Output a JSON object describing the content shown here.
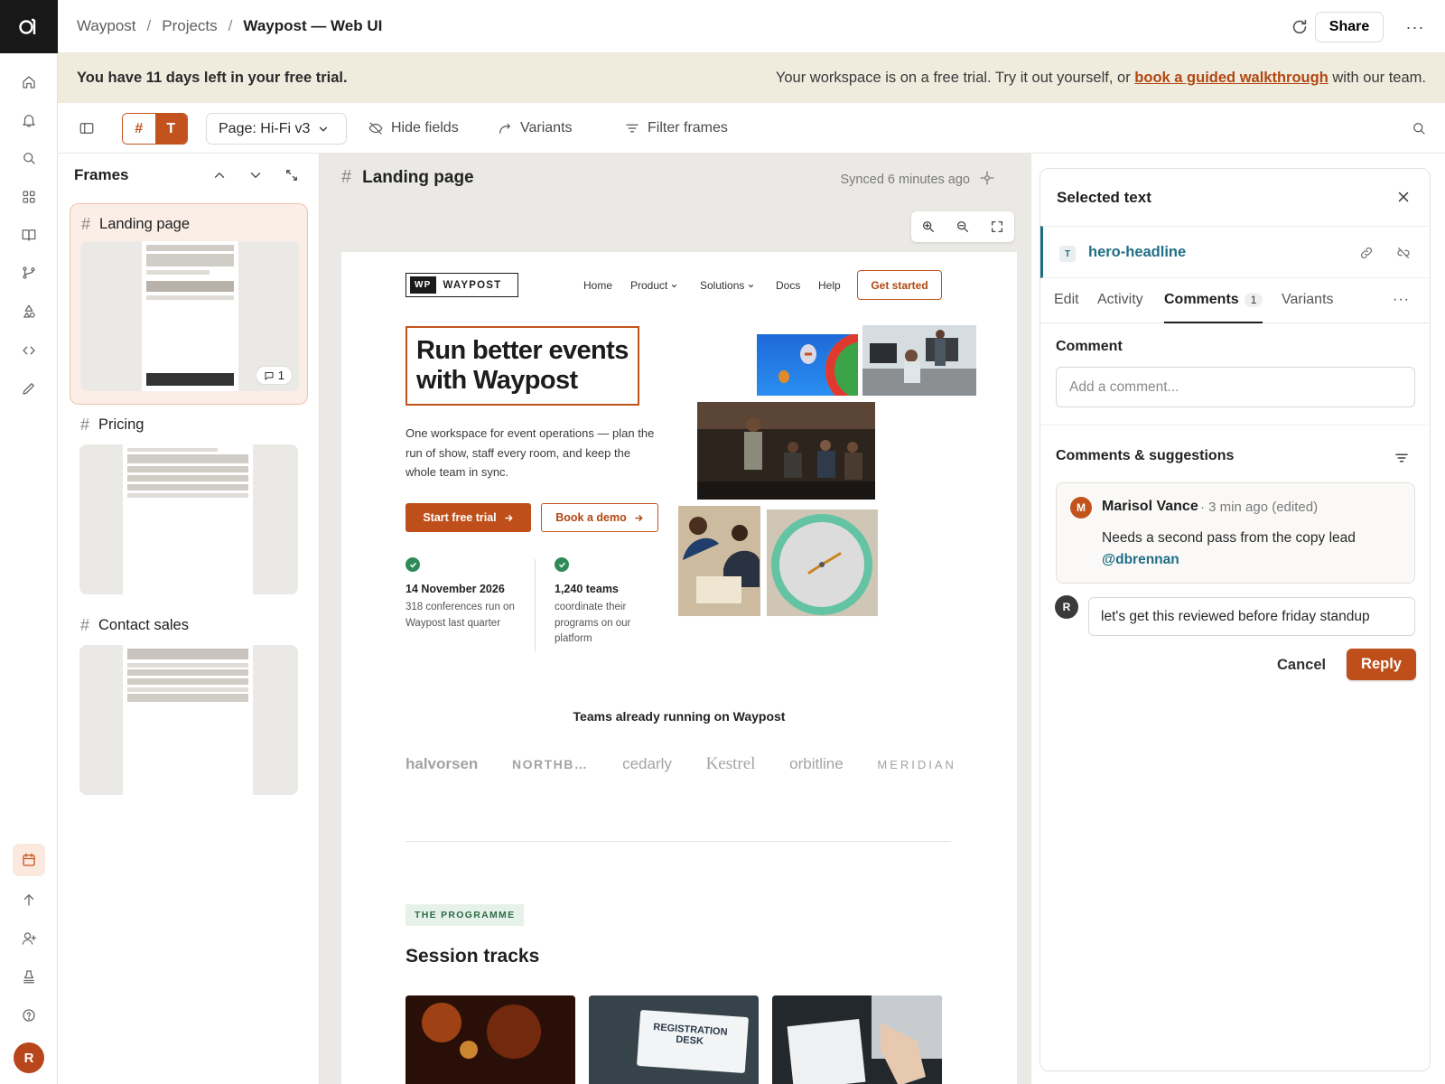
{
  "breadcrumb": {
    "items": [
      "Waypost",
      "Projects",
      "Waypost — Web UI"
    ],
    "separator": "/"
  },
  "topbar": {
    "share_label": "Share",
    "more": "···"
  },
  "banner": {
    "left": "You have 11 days left in your free trial.",
    "right_before": "Your workspace is on a free trial. Try it out yourself, or ",
    "link": "book a guided walkthrough",
    "right_after": " with our team."
  },
  "toolbar": {
    "seg_frame": "#",
    "seg_text": "T",
    "page": "Page: Hi-Fi v3",
    "hide_fields": "Hide fields",
    "variants": "Variants",
    "filter_frames": "Filter frames"
  },
  "frames": {
    "title": "Frames",
    "items": [
      {
        "name": "Landing page",
        "comments": "1"
      },
      {
        "name": "Pricing"
      },
      {
        "name": "Contact sales"
      }
    ]
  },
  "canvas": {
    "frame_title": "Landing page",
    "synced": "Synced 6 minutes ago"
  },
  "site": {
    "logo_mark": "WP",
    "logo_name": "WAYPOST",
    "nav": [
      "Home",
      "Product",
      "Solutions",
      "Docs",
      "Help"
    ],
    "cta": "Get started",
    "hero_line1": "Run better events",
    "hero_line2": "with Waypost",
    "subhead": "One workspace for event operations — plan the run of show, staff every room, and keep the whole team in sync.",
    "primary_btn": "Start free trial",
    "secondary_btn": "Book a demo",
    "stats": [
      {
        "value": "14 November 2026",
        "desc": "318 conferences run on Waypost last quarter"
      },
      {
        "value": "1,240 teams",
        "desc": "coordinate their programs on our platform"
      }
    ],
    "teams_heading": "Teams already running on Waypost",
    "logos": [
      "halvorsen",
      "NORTHB…",
      "cedarly",
      "Kestrel",
      "orbitline",
      "MERIDIAN"
    ],
    "tag": "THE PROGRAMME",
    "tracks_heading": "Session tracks",
    "track_image_text": "REGISTRATION DESK"
  },
  "panel": {
    "title": "Selected text",
    "selected_type": "T",
    "selected_name": "hero-headline",
    "tabs": [
      "Edit",
      "Activity",
      "Comments",
      "Variants"
    ],
    "comments_count": "1",
    "comment_label": "Comment",
    "comment_placeholder": "Add a comment...",
    "suggestions_label": "Comments & suggestions",
    "comment": {
      "avatar": "M",
      "author": "Marisol Vance",
      "meta": "· 3 min ago (edited)",
      "body": "Needs a second pass from the copy lead",
      "mention": "@dbrennan"
    },
    "reply_avatar": "R",
    "reply_value": "let's get this reviewed before friday standup",
    "cancel": "Cancel",
    "reply": "Reply"
  },
  "user": {
    "avatar": "R"
  },
  "colors": {
    "accent": "#c2531d",
    "banner_bg": "#efecde",
    "link_teal": "#1f6e86",
    "success": "#2e8b57"
  }
}
